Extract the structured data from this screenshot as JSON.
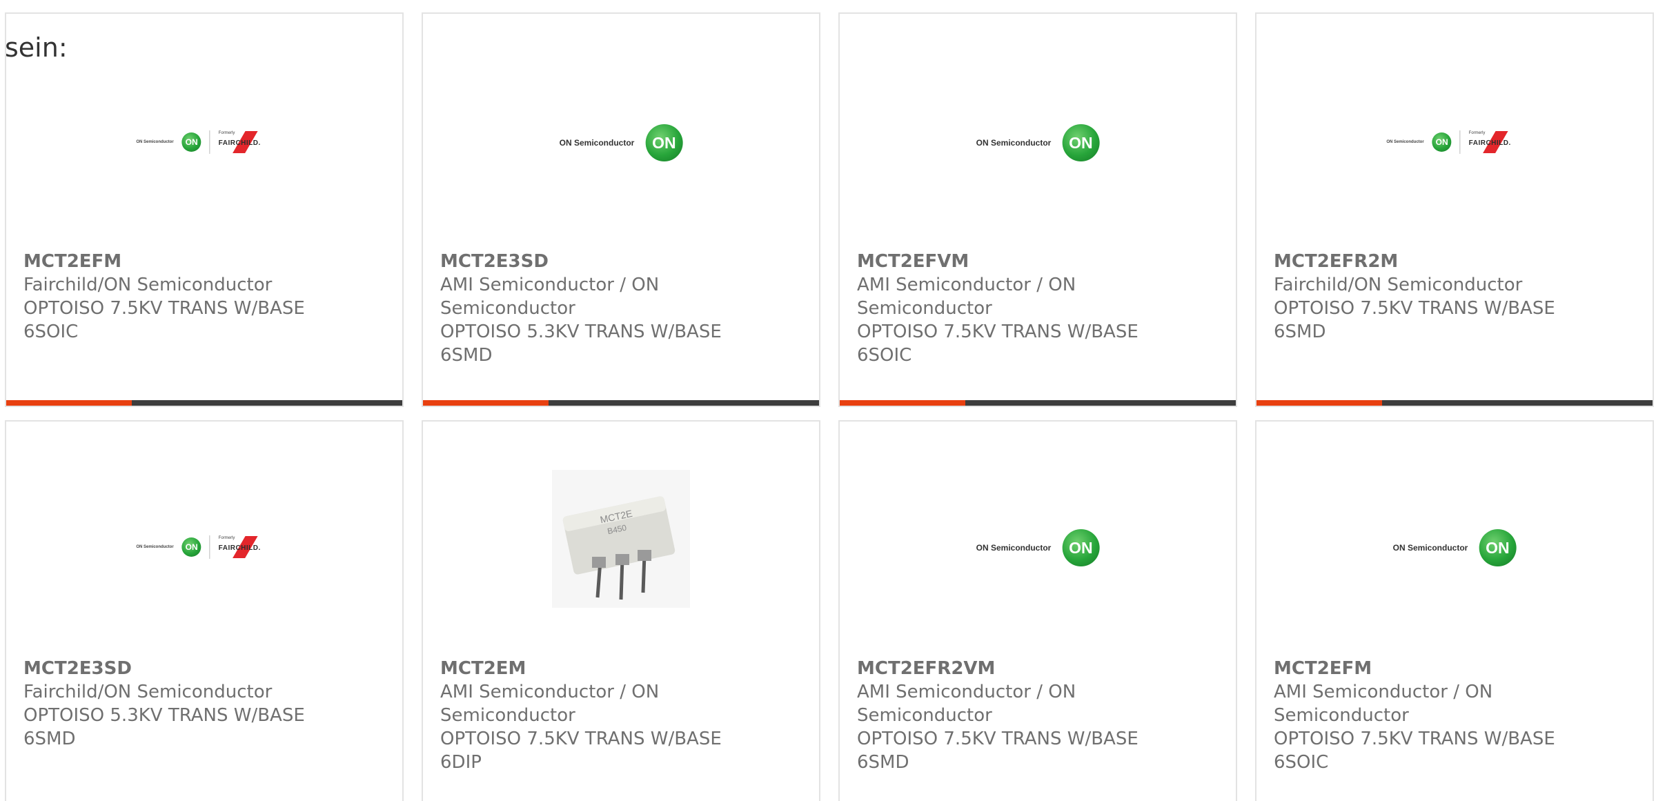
{
  "intro_text": "sein:",
  "colors": {
    "card_border": "#e3e3e3",
    "text": "#6f6f6f",
    "accent": "#e84010",
    "bar": "#3d3d3d",
    "on_green": "#27a53a",
    "fairchild_red": "#e3262b"
  },
  "logos": {
    "on_semiconductor": "ON Semiconductor",
    "on_badge": "ON",
    "formerly": "Formerly",
    "fairchild": "FAIRCHILD."
  },
  "chip_marking": {
    "line1": "MCT2E",
    "line2": "B450"
  },
  "products": [
    {
      "part": "MCT2EFM",
      "manufacturer": "Fairchild/ON Semiconductor",
      "description": "OPTOISO 7.5KV TRANS W/BASE",
      "package": "6SOIC",
      "image": "on-fairchild-logo"
    },
    {
      "part": "MCT2E3SD",
      "manufacturer": "AMI Semiconductor / ON Semiconductor",
      "description": "OPTOISO 5.3KV TRANS W/BASE",
      "package": "6SMD",
      "image": "on-semiconductor-logo"
    },
    {
      "part": "MCT2EFVM",
      "manufacturer": "AMI Semiconductor / ON Semiconductor",
      "description": "OPTOISO 7.5KV TRANS W/BASE",
      "package": "6SOIC",
      "image": "on-semiconductor-logo"
    },
    {
      "part": "MCT2EFR2M",
      "manufacturer": "Fairchild/ON Semiconductor",
      "description": "OPTOISO 7.5KV TRANS W/BASE",
      "package": "6SMD",
      "image": "on-fairchild-logo"
    },
    {
      "part": "MCT2E3SD",
      "manufacturer": "Fairchild/ON Semiconductor",
      "description": "OPTOISO 5.3KV TRANS W/BASE",
      "package": "6SMD",
      "image": "on-fairchild-logo"
    },
    {
      "part": "MCT2EM",
      "manufacturer": "AMI Semiconductor / ON Semiconductor",
      "description": "OPTOISO 7.5KV TRANS W/BASE",
      "package": "6DIP",
      "image": "chip-photo"
    },
    {
      "part": "MCT2EFR2VM",
      "manufacturer": "AMI Semiconductor / ON Semiconductor",
      "description": "OPTOISO 7.5KV TRANS W/BASE",
      "package": "6SMD",
      "image": "on-semiconductor-logo"
    },
    {
      "part": "MCT2EFM",
      "manufacturer": "AMI Semiconductor / ON Semiconductor",
      "description": "OPTOISO 7.5KV TRANS W/BASE",
      "package": "6SOIC",
      "image": "on-semiconductor-logo"
    }
  ]
}
